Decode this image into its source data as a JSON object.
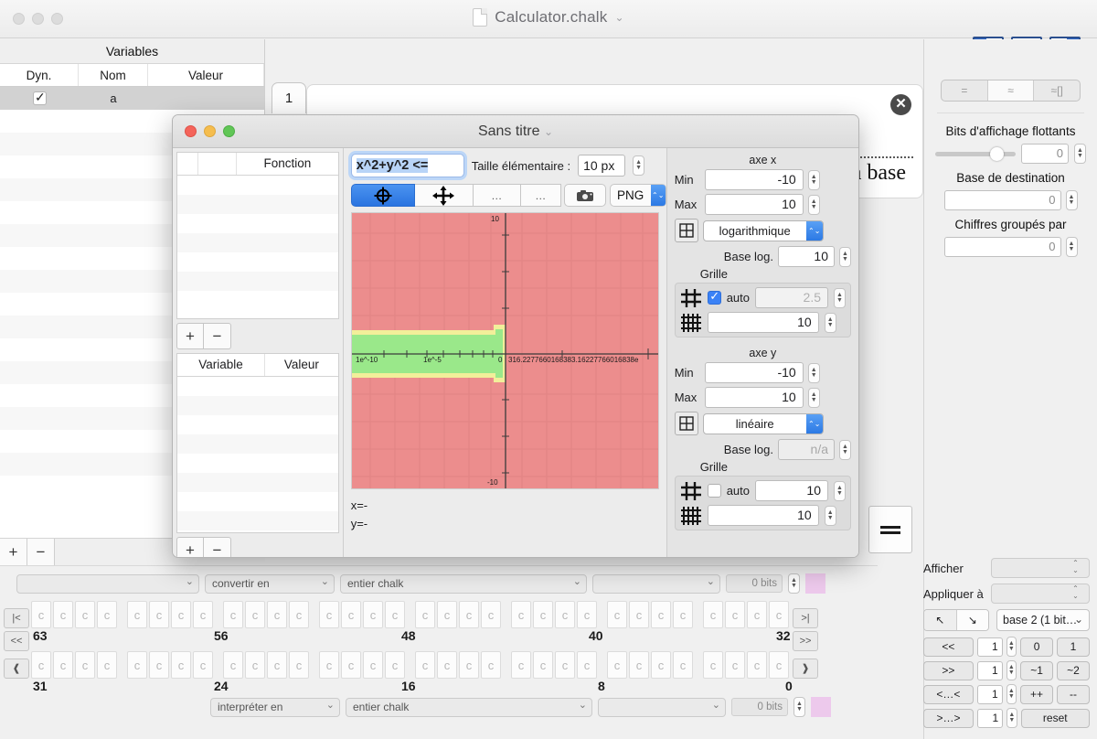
{
  "window": {
    "document_title": "Calculator.chalk",
    "title_chevron": "⌄"
  },
  "panel_toggles": [
    {
      "name": "left-panel-toggle"
    },
    {
      "name": "bottom-panel-toggle"
    },
    {
      "name": "right-panel-toggle"
    }
  ],
  "variables_panel": {
    "title": "Variables",
    "columns": [
      "Dyn.",
      "Nom",
      "Valeur"
    ],
    "rows": [
      {
        "dyn": true,
        "nom": "a",
        "valeur": ""
      }
    ],
    "add_label": "+",
    "remove_label": "−"
  },
  "tab": {
    "label": "1"
  },
  "backdrop_card": {
    "base_text": "a base",
    "close_label": "✕"
  },
  "right_sidebar": {
    "segmented": [
      {
        "label": "=",
        "selected": false
      },
      {
        "label": "≈",
        "selected": true
      },
      {
        "label": "≈[]",
        "selected": false
      }
    ],
    "float_bits_label": "Bits d'affichage flottants",
    "float_bits_value": "0",
    "dest_base_label": "Base de destination",
    "dest_base_value": "0",
    "grouped_digits_label": "Chiffres groupés par",
    "grouped_digits_value": "0",
    "equals_button": "=",
    "afficher_label": "Afficher",
    "afficher_value": "",
    "appliquer_label": "Appliquer à",
    "appliquer_value": "",
    "base_popup": "base 2 (1 bit…",
    "arrow_up_left": "↖",
    "arrow_down_right": "↘",
    "shift_rows": [
      {
        "btn": "<<",
        "value": "1"
      },
      {
        "btn": ">>",
        "value": "1"
      },
      {
        "btn": "<…<",
        "value": "1"
      },
      {
        "btn": ">…>",
        "value": "1"
      }
    ],
    "op_buttons": [
      "0",
      "1",
      "~1",
      "~2",
      "++",
      "--"
    ],
    "reset_label": "reset"
  },
  "bit_editor": {
    "top_bar": {
      "source_value": "",
      "convert_label": "convertir en",
      "type_value": "entier chalk",
      "extra_value": "",
      "bits_label": "0 bits"
    },
    "bottom_bar": {
      "interpret_label": "interpréter en",
      "type_value": "entier chalk",
      "extra_value": "",
      "bits_label": "0 bits"
    },
    "bit_glyph": "c",
    "row1_labels": [
      "63",
      "56",
      "48",
      "40",
      "32"
    ],
    "row2_labels": [
      "31",
      "24",
      "16",
      "8",
      "0"
    ],
    "nav_buttons_left": [
      "|<",
      "<<",
      "❰"
    ],
    "nav_buttons_right": [
      ">|",
      ">>",
      "❱"
    ]
  },
  "plot_window": {
    "title": "Sans titre",
    "title_chevron": "⌄",
    "function_column": "Fonction",
    "expression": "x^2+y^2 <=",
    "elem_size_label": "Taille élémentaire :",
    "elem_size_value": "10 px",
    "toolbar": [
      {
        "name": "target-icon",
        "label": "⊕",
        "selected": true
      },
      {
        "name": "move-icon",
        "label": "✥",
        "selected": false
      },
      {
        "name": "more-1",
        "label": "…",
        "selected": false
      },
      {
        "name": "more-2",
        "label": "…",
        "selected": false
      },
      {
        "name": "camera-icon",
        "label": "📷",
        "selected": false
      }
    ],
    "export_format": "PNG",
    "var_table": {
      "columns": [
        "Variable",
        "Valeur"
      ]
    },
    "add_label": "+",
    "remove_label": "−",
    "readout_x": "x=-",
    "readout_y": "y=-",
    "axis_x": {
      "header": "axe x",
      "min_label": "Min",
      "min": "-10",
      "max_label": "Max",
      "max": "10",
      "scale": "logarithmique",
      "base_log_label": "Base log.",
      "base_log": "10",
      "grid_label": "Grille",
      "grid_auto": true,
      "grid_major": "2.5",
      "grid_minor": "10"
    },
    "axis_y": {
      "header": "axe y",
      "min_label": "Min",
      "min": "-10",
      "max_label": "Max",
      "max": "10",
      "scale": "linéaire",
      "base_log_label": "Base log.",
      "base_log": "n/a",
      "grid_label": "Grille",
      "grid_auto": false,
      "grid_major": "10",
      "grid_minor": "10"
    },
    "plot": {
      "x_tick_labels": [
        "1e^-10",
        "1e^-5",
        "0",
        "316.227766016838",
        "3.16227766016838e"
      ],
      "y_tick_labels": [
        "10",
        "-10"
      ],
      "region_true_color": "#9ae88a",
      "region_false_color": "#ec8d8d",
      "region_edge_color": "#f2ef9a"
    }
  }
}
